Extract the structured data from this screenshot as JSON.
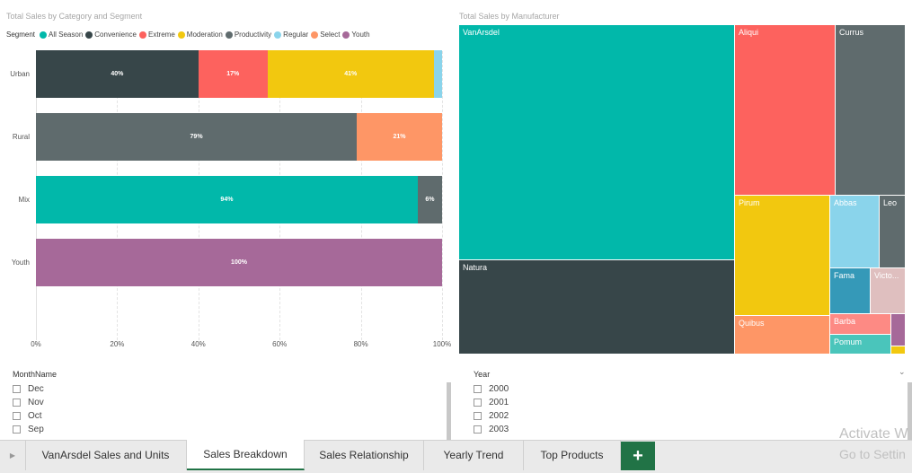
{
  "bar_chart": {
    "title": "Total Sales by Category and Segment",
    "legend_title": "Segment",
    "legend": [
      {
        "name": "All Season",
        "color": "#01B8AA"
      },
      {
        "name": "Convenience",
        "color": "#374649"
      },
      {
        "name": "Extreme",
        "color": "#FD625E"
      },
      {
        "name": "Moderation",
        "color": "#F2C80F"
      },
      {
        "name": "Productivity",
        "color": "#5F6B6D"
      },
      {
        "name": "Regular",
        "color": "#8AD4EB"
      },
      {
        "name": "Select",
        "color": "#FE9666"
      },
      {
        "name": "Youth",
        "color": "#A66999"
      }
    ],
    "x_ticks": [
      "0%",
      "20%",
      "40%",
      "60%",
      "80%",
      "100%"
    ]
  },
  "chart_data": {
    "type": "bar",
    "stacked": "100%",
    "orientation": "horizontal",
    "categories": [
      "Urban",
      "Rural",
      "Mix",
      "Youth"
    ],
    "series": [
      {
        "name": "Convenience",
        "values": [
          40,
          0,
          0,
          0
        ]
      },
      {
        "name": "Extreme",
        "values": [
          17,
          0,
          0,
          0
        ]
      },
      {
        "name": "Moderation",
        "values": [
          41,
          0,
          0,
          0
        ]
      },
      {
        "name": "Regular",
        "values": [
          2,
          0,
          0,
          0
        ]
      },
      {
        "name": "Productivity",
        "values": [
          0,
          79,
          6,
          0
        ]
      },
      {
        "name": "Select",
        "values": [
          0,
          21,
          0,
          0
        ]
      },
      {
        "name": "All Season",
        "values": [
          0,
          0,
          94,
          0
        ]
      },
      {
        "name": "Youth",
        "values": [
          0,
          0,
          0,
          100
        ]
      }
    ],
    "rows": [
      {
        "category": "Urban",
        "segments": [
          {
            "series": "Convenience",
            "value": 40,
            "label": "40%"
          },
          {
            "series": "Extreme",
            "value": 17,
            "label": "17%"
          },
          {
            "series": "Moderation",
            "value": 41,
            "label": "41%"
          },
          {
            "series": "Regular",
            "value": 2,
            "label": ""
          }
        ]
      },
      {
        "category": "Rural",
        "segments": [
          {
            "series": "Productivity",
            "value": 79,
            "label": "79%"
          },
          {
            "series": "Select",
            "value": 21,
            "label": "21%"
          }
        ]
      },
      {
        "category": "Mix",
        "segments": [
          {
            "series": "All Season",
            "value": 94,
            "label": "94%"
          },
          {
            "series": "Productivity",
            "value": 6,
            "label": "6%"
          }
        ]
      },
      {
        "category": "Youth",
        "segments": [
          {
            "series": "Youth",
            "value": 100,
            "label": "100%"
          }
        ]
      }
    ],
    "xlim": [
      0,
      100
    ],
    "title": "Total Sales by Category and Segment",
    "grid": true,
    "legend_placement": "top-left"
  },
  "treemap": {
    "title": "Total Sales by Manufacturer",
    "tiles": [
      {
        "name": "VanArsdel",
        "color": "#01B8AA"
      },
      {
        "name": "Natura",
        "color": "#374649"
      },
      {
        "name": "Aliqui",
        "color": "#FD625E"
      },
      {
        "name": "Currus",
        "color": "#5F6B6D"
      },
      {
        "name": "Pirum",
        "color": "#F2C80F"
      },
      {
        "name": "Quibus",
        "color": "#FE9666"
      },
      {
        "name": "Abbas",
        "color": "#8AD4EB"
      },
      {
        "name": "Leo",
        "color": "#5F6B6D"
      },
      {
        "name": "Fama",
        "color": "#3599B8"
      },
      {
        "name": "Victo...",
        "color": "#DFBFBF"
      },
      {
        "name": "Barba",
        "color": "#FD8A84"
      },
      {
        "name": "Pomum",
        "color": "#4AC5BB"
      },
      {
        "name": "",
        "color": "#A66999"
      },
      {
        "name": "",
        "color": "#F2C80F"
      }
    ]
  },
  "slicer_month": {
    "title": "MonthName",
    "items": [
      "Dec",
      "Nov",
      "Oct",
      "Sep"
    ]
  },
  "slicer_year": {
    "title": "Year",
    "items": [
      "2000",
      "2001",
      "2002",
      "2003"
    ]
  },
  "tabs": [
    {
      "label": "VanArsdel Sales and Units",
      "active": false
    },
    {
      "label": "Sales Breakdown",
      "active": true
    },
    {
      "label": "Sales Relationship",
      "active": false
    },
    {
      "label": "Yearly Trend",
      "active": false
    },
    {
      "label": "Top Products",
      "active": false
    }
  ],
  "add_tab_label": "+",
  "watermark": {
    "line1": "Activate W",
    "line2": "Go to Settin"
  },
  "accent_color": "#217346"
}
